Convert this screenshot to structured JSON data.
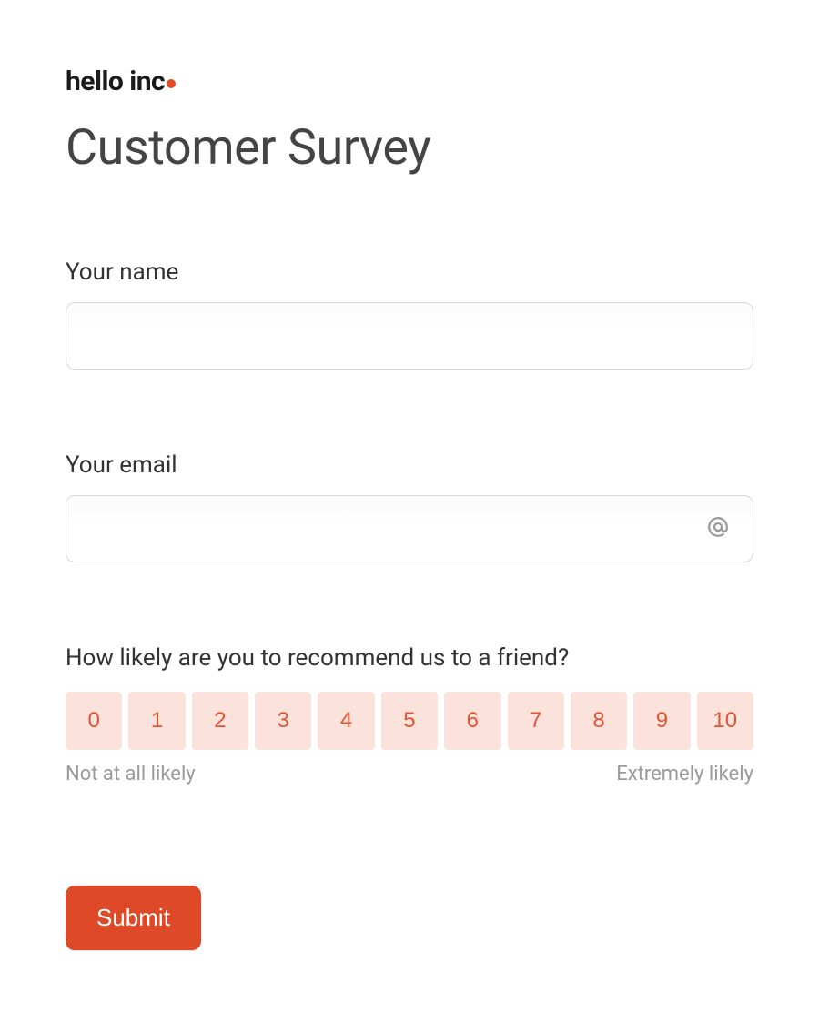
{
  "brand": {
    "logo_text": "hello inc",
    "accent_color": "#e14a2a"
  },
  "page": {
    "title": "Customer Survey"
  },
  "fields": {
    "name": {
      "label": "Your name",
      "value": "",
      "placeholder": ""
    },
    "email": {
      "label": "Your email",
      "value": "",
      "placeholder": ""
    }
  },
  "nps": {
    "question": "How likely are you to recommend us to a friend?",
    "options": [
      "0",
      "1",
      "2",
      "3",
      "4",
      "5",
      "6",
      "7",
      "8",
      "9",
      "10"
    ],
    "low_label": "Not at all likely",
    "high_label": "Extremely likely"
  },
  "actions": {
    "submit_label": "Submit"
  },
  "colors": {
    "accent": "#e14a2a",
    "nps_bg": "#fbe3db",
    "nps_text": "#e05536",
    "muted_text": "#9a9a9a"
  }
}
